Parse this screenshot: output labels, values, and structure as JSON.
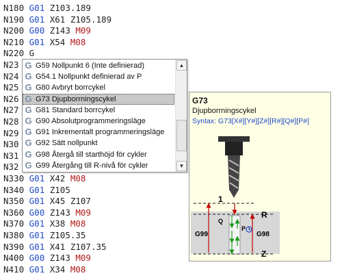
{
  "lines": [
    {
      "n": "N180",
      "parts": [
        {
          "t": " "
        },
        {
          "t": "G01",
          "c": "g"
        },
        {
          "t": " Z103.189"
        }
      ]
    },
    {
      "n": "N190",
      "parts": [
        {
          "t": " "
        },
        {
          "t": "G01",
          "c": "g"
        },
        {
          "t": " X61 Z105.189"
        }
      ]
    },
    {
      "n": "N200",
      "parts": [
        {
          "t": " "
        },
        {
          "t": "G00",
          "c": "g"
        },
        {
          "t": " Z143 "
        },
        {
          "t": "M09",
          "c": "m"
        }
      ]
    },
    {
      "n": "N210",
      "parts": [
        {
          "t": " "
        },
        {
          "t": "G01",
          "c": "g"
        },
        {
          "t": " X54 "
        },
        {
          "t": "M08",
          "c": "m"
        }
      ]
    },
    {
      "n": "N220",
      "parts": [
        {
          "t": " G"
        }
      ]
    },
    {
      "n": "N23",
      "parts": []
    },
    {
      "n": "N24",
      "parts": []
    },
    {
      "n": "N25",
      "parts": []
    },
    {
      "n": "N26",
      "parts": []
    },
    {
      "n": "N27",
      "parts": []
    },
    {
      "n": "N28",
      "parts": []
    },
    {
      "n": "N29",
      "parts": []
    },
    {
      "n": "N30",
      "parts": []
    },
    {
      "n": "N31",
      "parts": []
    },
    {
      "n": "N32",
      "parts": []
    },
    {
      "n": "N330",
      "parts": [
        {
          "t": " "
        },
        {
          "t": "G01",
          "c": "g"
        },
        {
          "t": " X42 "
        },
        {
          "t": "M08",
          "c": "m"
        }
      ]
    },
    {
      "n": "N340",
      "parts": [
        {
          "t": " "
        },
        {
          "t": "G01",
          "c": "g"
        },
        {
          "t": " Z105"
        }
      ]
    },
    {
      "n": "N350",
      "parts": [
        {
          "t": " "
        },
        {
          "t": "G01",
          "c": "g"
        },
        {
          "t": " X45 Z107"
        }
      ]
    },
    {
      "n": "N360",
      "parts": [
        {
          "t": " "
        },
        {
          "t": "G00",
          "c": "g"
        },
        {
          "t": " Z143 "
        },
        {
          "t": "M09",
          "c": "m"
        }
      ]
    },
    {
      "n": "N370",
      "parts": [
        {
          "t": " "
        },
        {
          "t": "G01",
          "c": "g"
        },
        {
          "t": " X38 "
        },
        {
          "t": "M08",
          "c": "m"
        }
      ]
    },
    {
      "n": "N380",
      "parts": [
        {
          "t": " "
        },
        {
          "t": "G01",
          "c": "g"
        },
        {
          "t": " Z105.35"
        }
      ]
    },
    {
      "n": "N390",
      "parts": [
        {
          "t": " "
        },
        {
          "t": "G01",
          "c": "g"
        },
        {
          "t": " X41 Z107.35"
        }
      ]
    },
    {
      "n": "N400",
      "parts": [
        {
          "t": " "
        },
        {
          "t": "G00",
          "c": "g"
        },
        {
          "t": " Z143 "
        },
        {
          "t": "M09",
          "c": "m"
        }
      ]
    },
    {
      "n": "N410",
      "parts": [
        {
          "t": " "
        },
        {
          "t": "G01",
          "c": "g"
        },
        {
          "t": " X34 "
        },
        {
          "t": "M08",
          "c": "m"
        }
      ]
    }
  ],
  "autocomplete": {
    "items": [
      {
        "label": "G59 Nollpunkt 6 (Inte definierad)",
        "icon": "g-code-icon"
      },
      {
        "label": "G54.1 Nollpunkt definierad av P",
        "icon": "g-code-icon"
      },
      {
        "label": "G80 Avbryt borrcykel",
        "icon": "g-code-icon"
      },
      {
        "label": "G73 Djupborrningscykel",
        "icon": "g-code-icon",
        "selected": true
      },
      {
        "label": "G81 Standard borrcykel",
        "icon": "g-code-icon"
      },
      {
        "label": "G90 Absolutprogrammeringsläge",
        "icon": "g-code-icon"
      },
      {
        "label": "G91 Inkrementalt programmeringsläge",
        "icon": "g-code-icon"
      },
      {
        "label": "G92 Sätt nollpunkt",
        "icon": "g-code-icon"
      },
      {
        "label": "G98 Återgå till starthöjd för cykler",
        "icon": "g-code-icon"
      },
      {
        "label": "G99 Återgång till R-nivå för cykler",
        "icon": "g-code-icon"
      }
    ],
    "scroll_up_icon": "triangle-up-icon",
    "scroll_down_icon": "triangle-down-icon"
  },
  "tooltip": {
    "title": "G73",
    "description": "Djupborrningscykel",
    "syntax": "Syntax: G73[X#][Y#][Z#][R#][Q#][P#]",
    "diagram_labels": {
      "initial": "1",
      "r": "R",
      "z": "Z",
      "g99": "G99",
      "g98": "G98",
      "q": "Q",
      "p": "P"
    },
    "colors": {
      "red": "#c00000",
      "green": "#1f9a1f",
      "blue": "#1f49c7",
      "tool": "#333333"
    }
  },
  "colors": {
    "gcode": "#1f49c7",
    "mcode": "#b11a1a",
    "text": "#222222"
  }
}
